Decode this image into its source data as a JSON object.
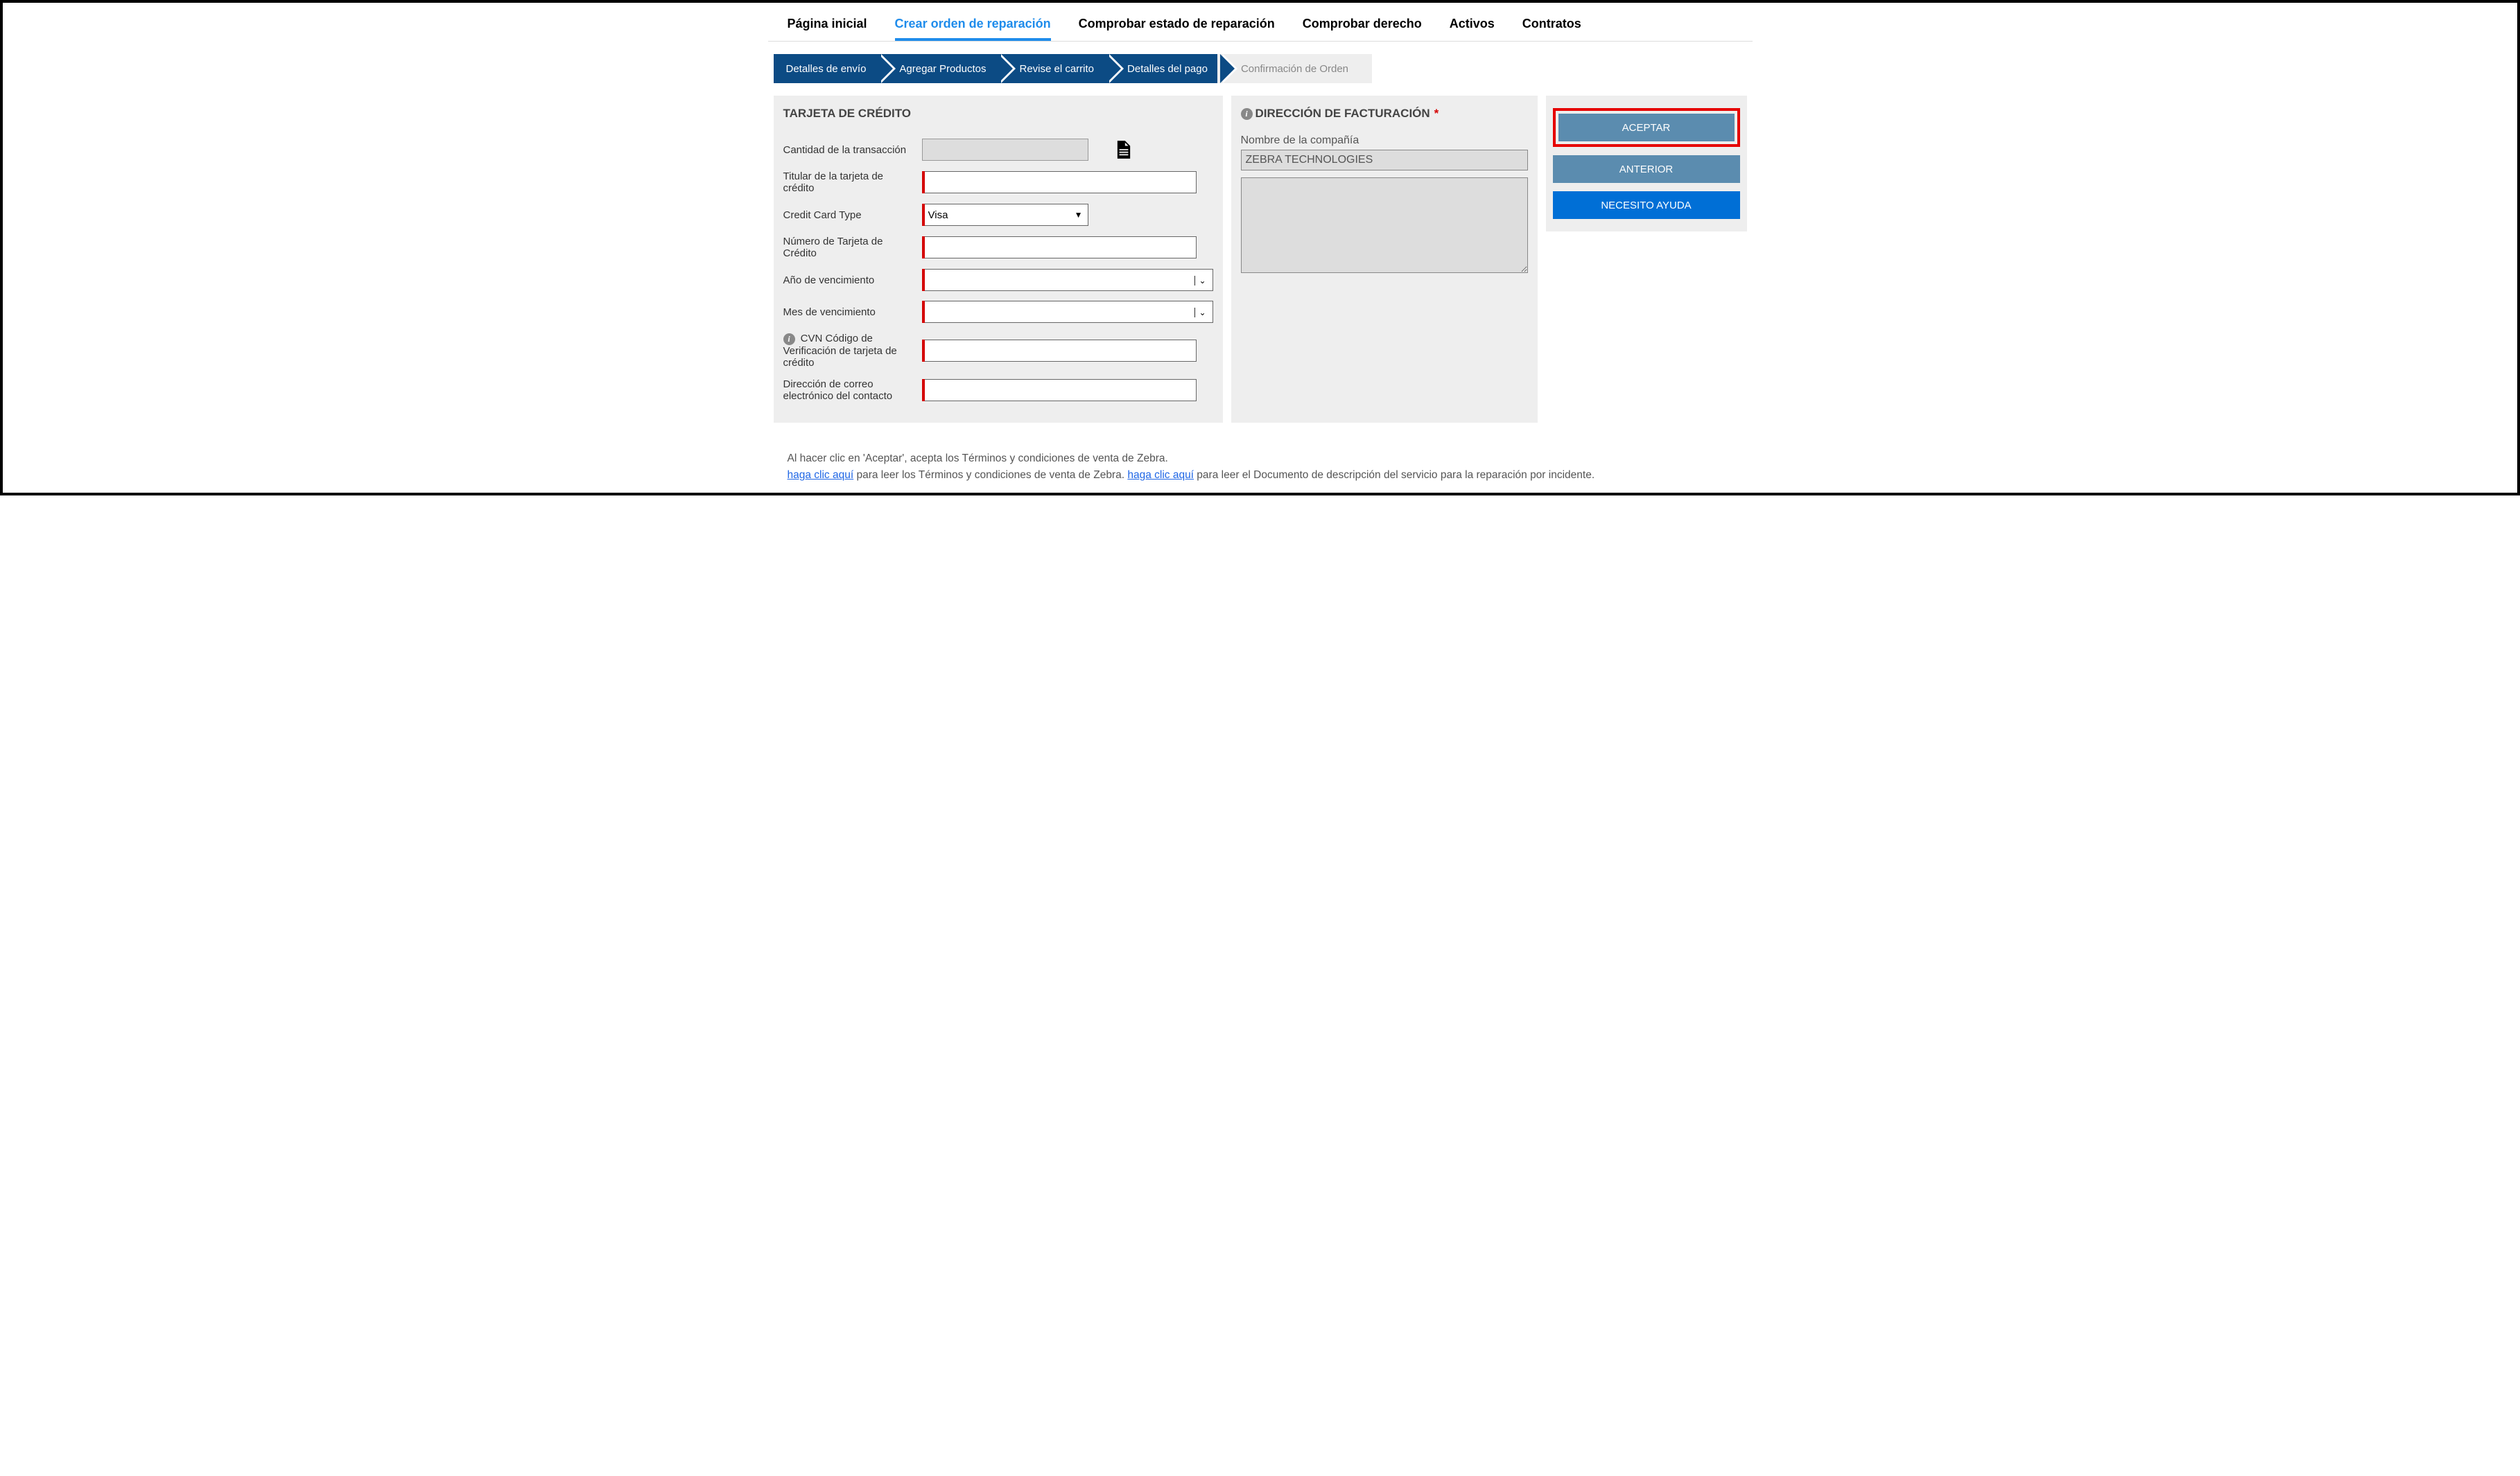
{
  "topnav": {
    "items": [
      {
        "label": "Página inicial",
        "active": false
      },
      {
        "label": "Crear orden de reparación",
        "active": true
      },
      {
        "label": "Comprobar estado de reparación",
        "active": false
      },
      {
        "label": "Comprobar derecho",
        "active": false
      },
      {
        "label": "Activos",
        "active": false
      },
      {
        "label": "Contratos",
        "active": false
      }
    ]
  },
  "stepper": [
    {
      "label": "Detalles de envío",
      "active": true
    },
    {
      "label": "Agregar Productos",
      "active": true
    },
    {
      "label": "Revise el carrito",
      "active": true
    },
    {
      "label": "Detalles del pago",
      "active": true
    },
    {
      "label": "Confirmación de Orden",
      "active": false
    }
  ],
  "credit_card": {
    "panel_title": "TARJETA DE CRÉDITO",
    "amount_label": "Cantidad de la transacción",
    "amount_value": "",
    "holder_label": "Titular de la tarjeta de crédito",
    "holder_value": "",
    "type_label": "Credit Card Type",
    "type_value": "Visa",
    "number_label": "Número de Tarjeta de Crédito",
    "number_value": "",
    "exp_year_label": "Año de vencimiento",
    "exp_year_value": "",
    "exp_month_label": "Mes de vencimiento",
    "exp_month_value": "",
    "cvn_label": "CVN Código de Verificación de tarjeta de crédito",
    "cvn_value": "",
    "email_label": "Dirección de correo electrónico del contacto",
    "email_value": ""
  },
  "billing": {
    "panel_title": "DIRECCIÓN DE FACTURACIÓN",
    "company_label": "Nombre de la compañía",
    "company_value": "ZEBRA TECHNOLOGIES",
    "address_value": ""
  },
  "actions": {
    "accept_label": "ACEPTAR",
    "previous_label": "ANTERIOR",
    "help_label": "NECESITO AYUDA"
  },
  "footer": {
    "line1": "Al hacer clic en 'Aceptar', acepta los Términos y condiciones de venta de Zebra.",
    "link1": "haga clic aquí",
    "mid1": " para leer los Términos y condiciones de venta de Zebra.  ",
    "link2": " haga clic aquí",
    "end2": " para leer el Documento de descripción del servicio para la reparación por incidente."
  }
}
